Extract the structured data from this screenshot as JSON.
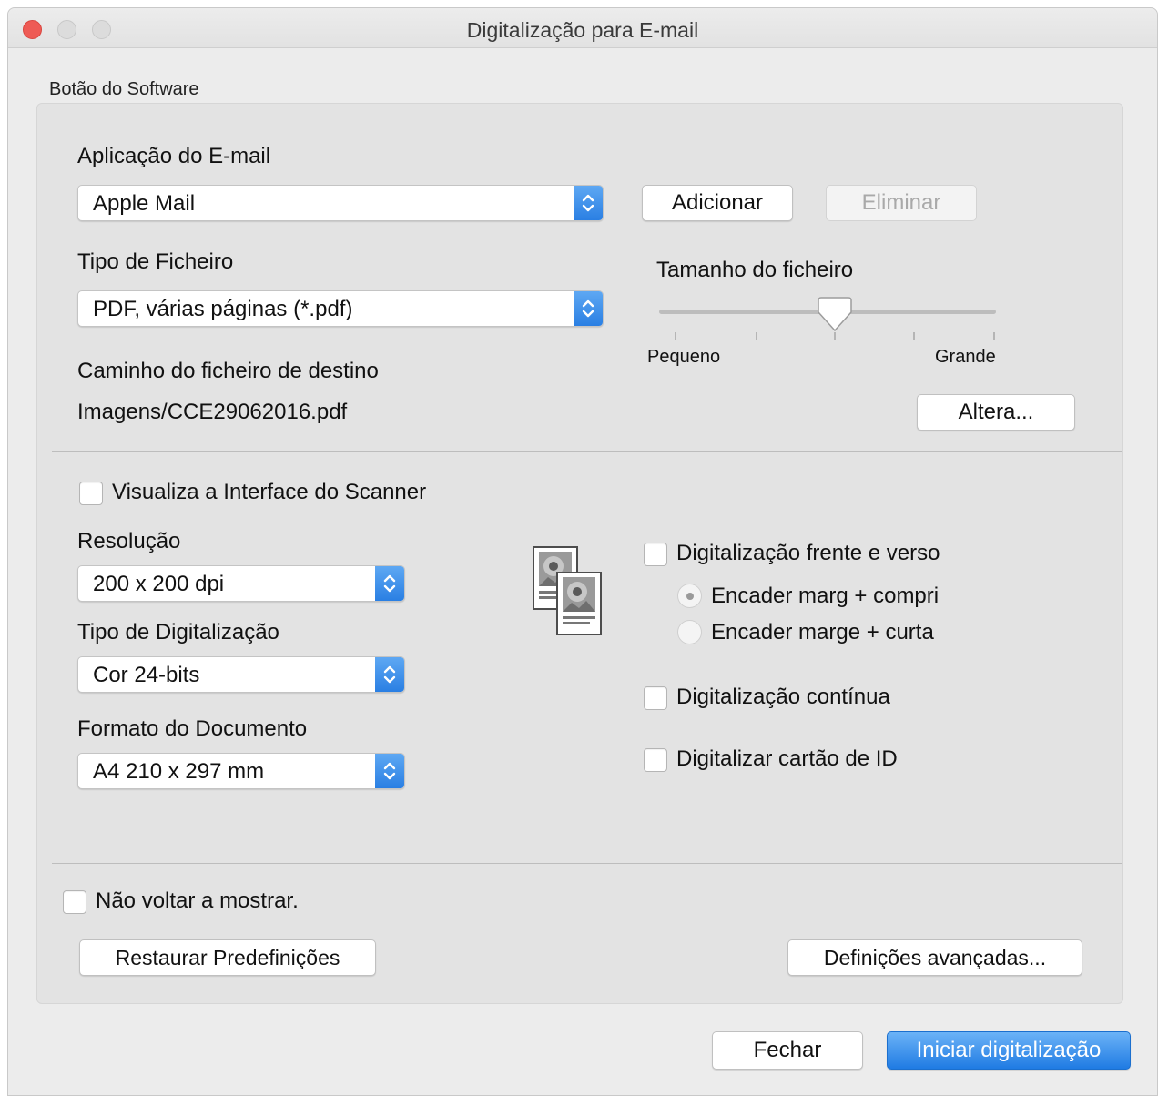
{
  "window": {
    "title": "Digitalização para E-mail"
  },
  "group": {
    "label": "Botão do Software"
  },
  "email_app": {
    "label": "Aplicação do E-mail",
    "value": "Apple Mail",
    "add_label": "Adicionar",
    "delete_label": "Eliminar"
  },
  "file_type": {
    "label": "Tipo de Ficheiro",
    "value": "PDF, várias páginas (*.pdf)"
  },
  "file_size": {
    "label": "Tamanho do ficheiro",
    "min_label": "Pequeno",
    "max_label": "Grande",
    "level_fraction": 0.5
  },
  "destination": {
    "label": "Caminho do ficheiro de destino",
    "path": "Imagens/CCE29062016.pdf",
    "change_label": "Altera..."
  },
  "scanner_ui": {
    "label": "Visualiza a Interface do Scanner",
    "checked": false
  },
  "resolution": {
    "label": "Resolução",
    "value": "200 x 200 dpi"
  },
  "scan_type": {
    "label": "Tipo de Digitalização",
    "value": "Cor 24-bits"
  },
  "doc_size": {
    "label": "Formato do Documento",
    "value": "A4 210 x 297 mm"
  },
  "duplex": {
    "label": "Digitalização frente e verso",
    "checked": false,
    "option_long": "Encader marg + compri",
    "option_short": "Encader marge + curta",
    "selected": "option_long"
  },
  "continuous": {
    "label": "Digitalização contínua",
    "checked": false
  },
  "id_card": {
    "label": "Digitalizar cartão de ID",
    "checked": false
  },
  "dont_show": {
    "label": "Não voltar a mostrar.",
    "checked": false
  },
  "buttons": {
    "restore": "Restaurar Predefinições",
    "advanced": "Definições avançadas...",
    "close": "Fechar",
    "start": "Iniciar digitalização"
  },
  "colors": {
    "accent": "#2a7fe3",
    "close_light": "#ee5b55"
  },
  "icons": {
    "stepper": "up-down-chevron-icon",
    "document": "duplex-document-icon"
  }
}
